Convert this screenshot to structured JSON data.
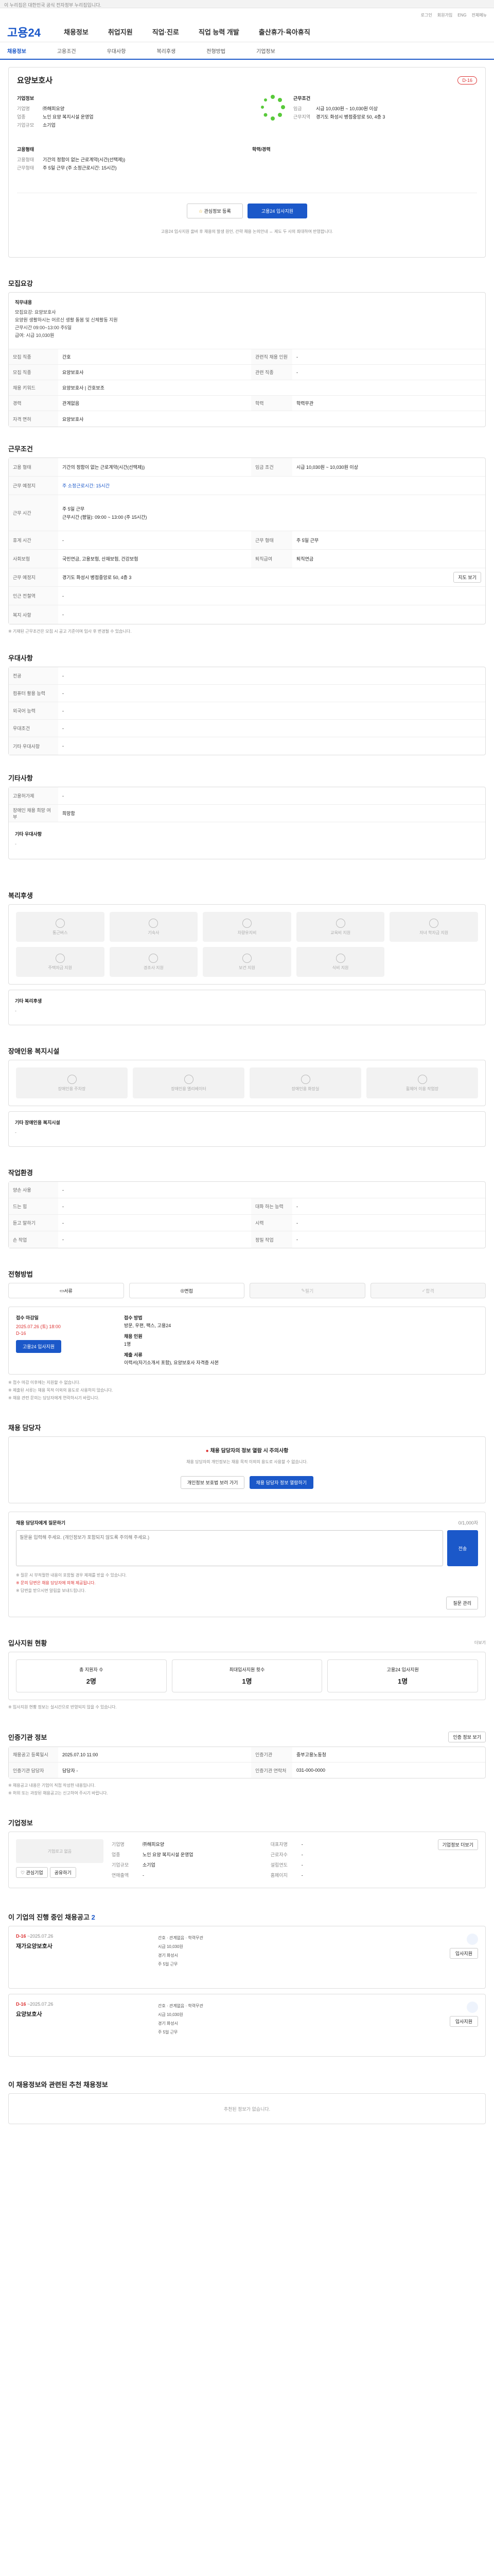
{
  "topbar": {
    "notice": "이 누리집은 대한민국 공식 전자정부 누리집입니다."
  },
  "util": {
    "links": [
      "로그인",
      "회원가입",
      "ENG",
      "전체메뉴"
    ]
  },
  "gnb": {
    "logo": "고용24",
    "menu": [
      "채용정보",
      "취업지원",
      "직업·진로",
      "직업 능력 개발",
      "출산휴가·육아휴직"
    ]
  },
  "subnav": {
    "items": [
      "채용정보",
      "고용조건",
      "우대사항",
      "복리후생",
      "전형방법",
      "기업정보"
    ]
  },
  "summary": {
    "company_title": "요양보호사",
    "badge": "D-16",
    "company_label": "기업정보",
    "company_rows": [
      {
        "k": "기업명",
        "v": "㈜해피요양"
      },
      {
        "k": "업종",
        "v": "노인 요양 복지시설 운영업"
      },
      {
        "k": "기업규모",
        "v": "소기업"
      }
    ],
    "pay_label": "근무조건",
    "pay_rows": [
      {
        "k": "임금",
        "v": "시급 10,030원 ~ 10,030원 이상"
      },
      {
        "k": "근무지역",
        "v": "경기도 화성시 병점중앙로 50, 4층 3"
      }
    ],
    "career_label": "고용형태",
    "career_rows": [
      {
        "k": "고용형태",
        "v": "기간의 정함이 없는 근로계약(시간(선택제))"
      },
      {
        "k": "근무형태",
        "v": "주 5일 근무 (주 소정근로시간: 15시간)"
      }
    ],
    "edu_label": "학력/경력",
    "btn_scrap": "관심정보 등록",
    "btn_apply": "고용24 입사지원",
    "notice": "고용24 입사지원 올바 후 채용의 발생 원인, 간략 채용 논의안내 ↔ 제도 두 사의 최대하여 반영합니다."
  },
  "detail": {
    "title": "모집요강",
    "job_desc_label": "직무내용",
    "job_desc": "모집요강: 요양보호사\n요양원 생활하시는 어르신 생활 돌봄 및 신체활동 지원\n근무시간 09:00~13:00 주5일\n급여: 시급 10,030원",
    "rows": [
      {
        "k": "모집 직종",
        "v": "간호",
        "k2": "관련직 채용 인원",
        "v2": "-"
      },
      {
        "k": "모집 직종",
        "v": "요양보호사",
        "k2": "관련 직종",
        "v2": "-"
      },
      {
        "k": "채용 키워드",
        "v": "요양보호사 | 간호보조",
        "k2": "",
        "v2": ""
      },
      {
        "k": "경력",
        "v": "관계없음",
        "k2": "학력",
        "v2": "학력무관"
      },
      {
        "k": "자격 면허",
        "v": "요양보호사",
        "k2": "",
        "v2": ""
      }
    ]
  },
  "cond": {
    "title": "근무조건",
    "rows": [
      {
        "k": "고용 형태",
        "v": "기간의 정함이 없는 근로계약(시간(선택제))",
        "k2": "임금 조건",
        "v2": "시급 10,030원 ~ 10,030원 이상"
      },
      {
        "k": "근무 예정지",
        "v": "주 소정근로시간: 15시간",
        "k2": "",
        "v2": ""
      },
      {
        "k": "근무 시간",
        "v": "주 5일 근무\n근무시간 (평일): 09:00 ~ 13:00 (주 15시간)",
        "k2": "",
        "v2": ""
      },
      {
        "k": "휴게 시간",
        "v": "-",
        "k2": "근무 형태",
        "v2": "주 5일 근무"
      },
      {
        "k": "사회보험",
        "v": "국민연금, 고용보험, 산재보험, 건강보험",
        "k2": "퇴직급여",
        "v2": "퇴직연금"
      },
      {
        "k": "근무 예정지",
        "v": "경기도 화성시 병점중앙로 50, 4층 3",
        "k2": "",
        "v2": ""
      },
      {
        "k": "인근 전철역",
        "v": "-",
        "k2": "",
        "v2": ""
      },
      {
        "k": "복지 사항",
        "v": "-",
        "k2": "",
        "v2": ""
      }
    ],
    "map_btn": "지도 보기",
    "note": "※ 기재된 근무조건은 모집 시 공고 기준이며 입사 후 변경될 수 있습니다."
  },
  "pref": {
    "title": "우대사항",
    "rows": [
      {
        "k": "전공",
        "v": "-"
      },
      {
        "k": "컴퓨터 활용 능력",
        "v": "-"
      },
      {
        "k": "외국어 능력",
        "v": "-"
      },
      {
        "k": "우대조건",
        "v": "-"
      },
      {
        "k": "기타 우대사항",
        "v": "-"
      }
    ]
  },
  "etc": {
    "title": "기타사항",
    "rows": [
      {
        "k": "고용허가제",
        "v": "-"
      },
      {
        "k": "장애인 채용 희망 여부",
        "v": "희망함"
      }
    ],
    "note_label": "기타 우대사항",
    "note": "-"
  },
  "welfare": {
    "title": "복리후생",
    "items": [
      "통근버스",
      "기숙사",
      "차량유지비",
      "교육비 지원",
      "자녀 학자금 지원",
      "주택자금 지원",
      "경조사 지원",
      "보건 지원",
      "식비 지원"
    ],
    "other_label": "기타 복리후생",
    "other": "-"
  },
  "disabled": {
    "title": "장애인용 복지시설",
    "items": [
      "장애인용 주차장",
      "장애인용 엘리베이터",
      "장애인용 화장실",
      "휠체어 이용 작업장"
    ],
    "other_label": "기타 장애인용 복지시설",
    "other": "-"
  },
  "env": {
    "title": "작업환경",
    "rows": [
      {
        "k": "양손 사용",
        "v": "-",
        "k2": "",
        "v2": ""
      },
      {
        "k": "드는 힘",
        "v": "-",
        "k2": "대화 하는 능력",
        "v2": "-"
      },
      {
        "k": "듣고 말하기",
        "v": "-",
        "k2": "시력",
        "v2": "-"
      },
      {
        "k": "손 작업",
        "v": "-",
        "k2": "정밀 작업",
        "v2": "-"
      }
    ]
  },
  "process": {
    "title": "전형방법",
    "steps": [
      "서류",
      "면접",
      "필기",
      "합격"
    ],
    "deadline_label": "접수 마감일",
    "deadline": "2025.07.26 (토) 18:00",
    "deadline_badge": "D-16",
    "method_label": "접수 방법",
    "method": "방문, 우편, 팩스, 고용24",
    "count_label": "채용 인원",
    "count": "1명",
    "docs_label": "제출 서류",
    "docs": "이력서(자기소개서 포함), 요양보호사 자격증 사본",
    "apply_btn": "고용24 입사지원",
    "notes": [
      "※ 접수 마감 이후에는 지원할 수 없습니다.",
      "※ 제출된 서류는 채용 목적 이외의 용도로 사용하지 않습니다.",
      "※ 채용 관련 문의는 담당자에게 연락하시기 바랍니다."
    ]
  },
  "contact": {
    "title": "채용 담당자",
    "alert": "채용 담당자의 정보 열람 시 주의사항",
    "alert_body": "채용 담당자의 개인정보는 채용 목적 이외의 용도로 사용할 수 없습니다.",
    "btn_personal": "개인정보 보호법 보러 가기",
    "btn_view": "채용 담당자 정보 열람하기"
  },
  "inquiry": {
    "title": "채용 담당자에게 질문하기",
    "count_label": "0/1,000자",
    "placeholder": "질문을 입력해 주세요. (개인정보가 포함되지 않도록 주의해 주세요.)",
    "btn": "전송",
    "limit": "0 / 1000자",
    "notes": [
      "※ 질문 시 부적절한 내용이 포함될 경우 제재를 받을 수 있습니다.",
      "※ 문의 답변은 채용 담당자에 의해 제공됩니다.",
      "※ 답변을 받으시면 알림을 보내드립니다."
    ],
    "btn_manage": "질문 관리"
  },
  "stats": {
    "title": "입사지원 현황",
    "more": "더보기",
    "items": [
      {
        "label": "총 지원자 수",
        "value": "2명"
      },
      {
        "label": "최대입사지원 횟수",
        "value": "1명"
      },
      {
        "label": "고용24 입사지원",
        "value": "1명"
      }
    ],
    "note": "※ 입사지원 현황 정보는 실시간으로 반영되지 않을 수 있습니다."
  },
  "info": {
    "title": "인증기관 정보",
    "btn": "인증 정보 보기",
    "rows": [
      {
        "k": "채용공고 등록일시",
        "v": "2025.07.10 11:00",
        "k2": "인증기관",
        "v2": "중부고용노동청"
      },
      {
        "k": "인증기관 담당자",
        "v": "담당자 -",
        "k2": "인증기관 연락처",
        "v2": "031-000-0000"
      }
    ],
    "notes": [
      "※ 채용공고 내용은 기업이 직접 작성한 내용입니다.",
      "※ 허위 또는 과장된 채용공고는 신고하여 주시기 바랍니다."
    ]
  },
  "company": {
    "title": "기업정보",
    "logo_alt": "기업로고 없음",
    "btn_like": "관심기업",
    "btn_share": "공유하기",
    "rows": [
      {
        "k": "기업명",
        "v": "㈜해피요양",
        "k2": "대표자명",
        "v2": "-"
      },
      {
        "k": "업종",
        "v": "노인 요양 복지시설 운영업",
        "k2": "근로자수",
        "v2": "-"
      },
      {
        "k": "기업규모",
        "v": "소기업",
        "k2": "설립연도",
        "v2": "-"
      },
      {
        "k": "연매출액",
        "v": "-",
        "k2": "홈페이지",
        "v2": "-"
      }
    ],
    "btn_more": "기업정보 더보기"
  },
  "other_jobs": {
    "title": "이 기업의 진행 중인 채용공고",
    "count": "2",
    "items": [
      {
        "badge": "D-16",
        "date": "~2025.07.26",
        "title": "재가요양보호사",
        "tags": [
          "간호",
          "관계없음",
          "학력무관"
        ],
        "pay": "시급 10,030원",
        "loc": "경기 화성시",
        "type": "주 5일 근무",
        "btn": "입사지원"
      },
      {
        "badge": "D-16",
        "date": "~2025.07.26",
        "title": "요양보호사",
        "tags": [
          "간호",
          "관계없음",
          "학력무관"
        ],
        "pay": "시급 10,030원",
        "loc": "경기 화성시",
        "type": "주 5일 근무",
        "btn": "입사지원"
      }
    ]
  },
  "recommend": {
    "title": "이 채용정보와 관련된 추천 채용정보",
    "empty": "추천된 정보가 없습니다."
  }
}
